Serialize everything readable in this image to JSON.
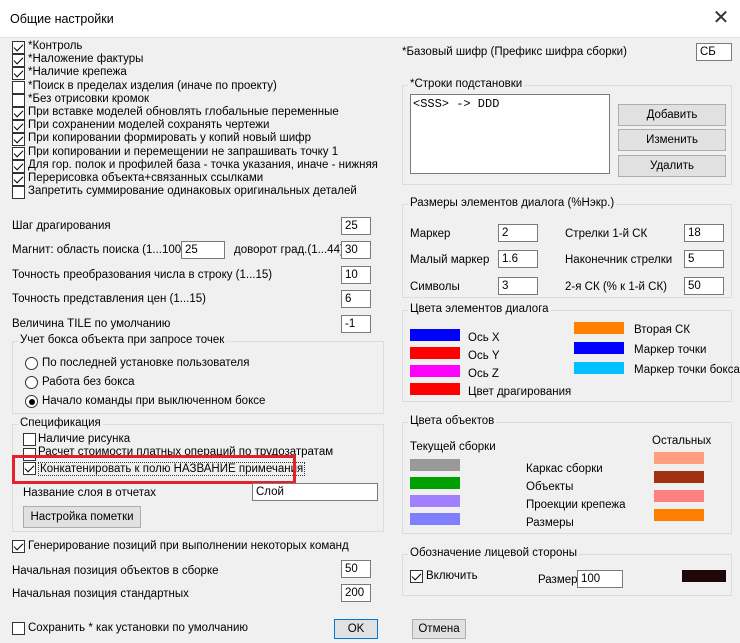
{
  "window": {
    "title": "Общие настройки",
    "close_icon": "close-icon"
  },
  "options": [
    {
      "label": "*Контроль",
      "checked": true
    },
    {
      "label": "*Наложение фактуры",
      "checked": true
    },
    {
      "label": "*Наличие крепежа",
      "checked": true
    },
    {
      "label": "*Поиск в пределах изделия (иначе по проекту)",
      "checked": false
    },
    {
      "label": "*Без отрисовки кромок",
      "checked": false
    },
    {
      "label": "При вставке моделей обновлять глобальные переменные",
      "checked": true
    },
    {
      "label": "При сохранении моделей сохранять чертежи",
      "checked": true
    },
    {
      "label": "При копировании формировать у копий новый шифр",
      "checked": true
    },
    {
      "label": "При копировании и перемещении не запрашивать точку 1",
      "checked": true
    },
    {
      "label": "Для гор. полок и профилей база - точка указания, иначе - нижняя",
      "checked": true
    },
    {
      "label": "Перерисовка объекта+связанных ссылками",
      "checked": true
    },
    {
      "label": "Запретить суммирование одинаковых оригинальных деталей",
      "checked": false
    }
  ],
  "drag_step": {
    "label": "Шаг драгирования",
    "value": "25"
  },
  "magnet": {
    "label": "Магнит: область поиска (1...100)",
    "value": "25"
  },
  "rotate": {
    "label": "доворот град.(1...44)",
    "value": "30"
  },
  "num_precision": {
    "label": "Точность преобразования числа в строку (1...15)",
    "value": "10"
  },
  "price_precision": {
    "label": "Точность представления цен (1...15)",
    "value": "6"
  },
  "tile": {
    "label": "Величина TILE по умолчанию",
    "value": "-1"
  },
  "bbox_group": {
    "title": "Учет бокса объекта при запросе точек",
    "options": [
      {
        "label": "По последней установке пользователя",
        "selected": false
      },
      {
        "label": "Работа без бокса",
        "selected": false
      },
      {
        "label": "Начало команды при выключенном боксе",
        "selected": true
      }
    ]
  },
  "spec_group": {
    "title": "Спецификация",
    "opt1": {
      "label": "Наличие рисунка",
      "checked": false
    },
    "opt2": {
      "label": "Расчет стоимости платных операций по трудозатратам",
      "checked": false
    },
    "opt3": {
      "label": "Конкатенировать к полю НАЗВАНИЕ примечания",
      "checked": true
    },
    "layer_label": "Название слоя в отчетах",
    "layer_value": "Слой",
    "mark_button": "Настройка пометки"
  },
  "gen_positions": {
    "label": "Генерирование позиций при выполнении некоторых команд",
    "checked": true
  },
  "start_pos_assembly": {
    "label": "Начальная позиция объектов в сборке",
    "value": "50"
  },
  "start_pos_std": {
    "label": "Начальная позиция стандартных",
    "value": "200"
  },
  "save_default": {
    "label": "Сохранить * как установки по умолчанию",
    "checked": false
  },
  "ok_button": "OK",
  "cancel_button": "Отмена",
  "base_code": {
    "label": "*Базовый шифр (Префикс шифра сборки)",
    "value": "СБ"
  },
  "subst": {
    "title": "*Строки подстановки",
    "items": [
      "<SSS> -> DDD"
    ],
    "add": "Добавить",
    "edit": "Изменить",
    "delete": "Удалить"
  },
  "sizes": {
    "title": "Размеры элементов диалога (%Нэкр.)",
    "marker": {
      "label": "Маркер",
      "value": "2"
    },
    "arrows1": {
      "label": "Стрелки 1-й СК",
      "value": "18"
    },
    "small_marker": {
      "label": "Малый маркер",
      "value": "1.6"
    },
    "arrow_tip": {
      "label": "Наконечник стрелки",
      "value": "5"
    },
    "symbols": {
      "label": "Символы",
      "value": "3"
    },
    "sk2": {
      "label": "2-я СК (% к 1-й СК)",
      "value": "50"
    }
  },
  "dialog_colors": {
    "title": "Цвета элементов диалога",
    "items": [
      {
        "label": "Ось X",
        "color": "#0000ff"
      },
      {
        "label": "Ось Y",
        "color": "#ff0000"
      },
      {
        "label": "Ось Z",
        "color": "#ff00ff"
      },
      {
        "label": "Цвет драгирования",
        "color": "#ff0000"
      }
    ],
    "items_right": [
      {
        "label": "Вторая СК",
        "color": "#ff8000"
      },
      {
        "label": "Маркер точки",
        "color": "#0000ff"
      },
      {
        "label": "Маркер точки бокса",
        "color": "#00c0ff"
      }
    ]
  },
  "object_colors": {
    "title": "Цвета объектов",
    "current_label": "Текущей сборки",
    "others_label": "Остальных",
    "rows": [
      {
        "label": "Каркас сборки",
        "current": "#999999",
        "other": "#ff9f80"
      },
      {
        "label": "Объекты",
        "current": "#00a000",
        "other": "#a03010"
      },
      {
        "label": "Проекции крепежа",
        "current": "#a080ff",
        "other": "#ff8080"
      },
      {
        "label": "Размеры",
        "current": "#8080ff",
        "other": "#ff8000"
      }
    ]
  },
  "face_side": {
    "title": "Обозначение лицевой стороны",
    "enable": {
      "label": "Включить",
      "checked": true
    },
    "size_label": "Размер",
    "size_value": "100",
    "color": "#200808"
  }
}
